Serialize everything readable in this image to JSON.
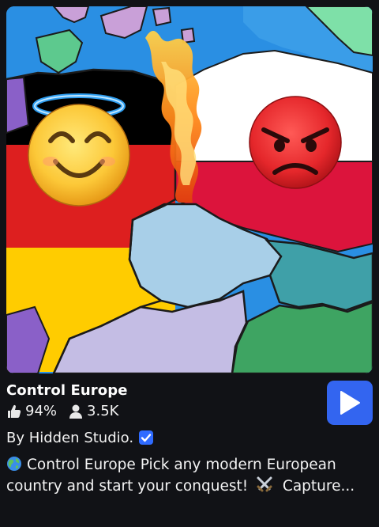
{
  "game": {
    "title": "Control Europe",
    "rating": "94%",
    "players": "3.5K",
    "creator": "By Hidden Studio.",
    "description_line1": "Control Europe Pick any modern European",
    "description_line2a": "country and start your conquest!",
    "description_line2b": "Capture..."
  },
  "icons": {
    "thumb": "thumbs-up-icon",
    "players": "person-icon",
    "verified": "verified-badge-icon",
    "play": "play-icon",
    "globe": "globe-emoji",
    "swords": "crossed-swords-emoji"
  },
  "colors": {
    "background": "#111216",
    "play_button": "#3365f0",
    "verified": "#2f6bff"
  }
}
